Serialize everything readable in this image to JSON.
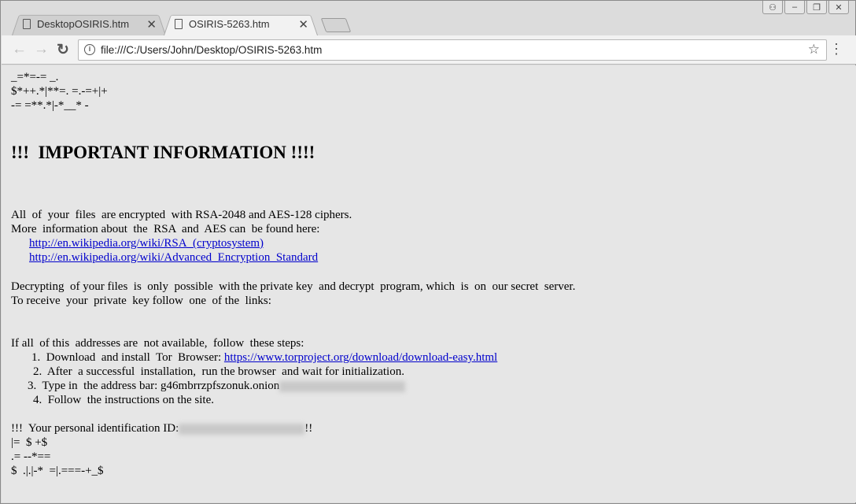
{
  "browser": {
    "tabs": [
      {
        "label": "DesktopOSIRIS.htm",
        "active": false
      },
      {
        "label": "OSIRIS-5263.htm",
        "active": true
      }
    ],
    "url": "file:///C:/Users/John/Desktop/OSIRIS-5263.htm"
  },
  "page": {
    "ascii_top": [
      "_=*=-= _.",
      "$*++.*|**=. =.-=+|+",
      "-= =**.*|-*__* -"
    ],
    "heading": "!!!  IMPORTANT INFORMATION !!!!",
    "p1": "All  of  your  files  are encrypted  with RSA-2048 and AES-128 ciphers.",
    "p2": "More  information about  the  RSA  and  AES can  be found here:",
    "link1": "http://en.wikipedia.org/wiki/RSA_(cryptosystem)",
    "link2": "http://en.wikipedia.org/wiki/Advanced_Encryption_Standard",
    "p3": "Decrypting  of your files  is  only  possible  with the private key  and decrypt  program, which  is  on  our secret  server.",
    "p4": "To receive  your  private  key follow  one  of the  links:",
    "p5": "If all  of this  addresses are  not available,  follow  these steps:",
    "step1_prefix": "1.  Download  and install  Tor  Browser: ",
    "step1_link": "https://www.torproject.org/download/download-easy.html",
    "step2": "2.  After  a successful  installation,  run the browser  and wait for initialization.",
    "step3_prefix": "3.  Type in  the address bar: g46mbrrzpfszonuk.onion",
    "step4": "4.  Follow  the instructions on the site.",
    "id_prefix": "!!!  Your personal identification ID:",
    "id_suffix": "!!",
    "ascii_bottom": [
      "|=  $ +$",
      ".= --*==",
      "$  .|.|-*  =|.===-+_$"
    ]
  }
}
